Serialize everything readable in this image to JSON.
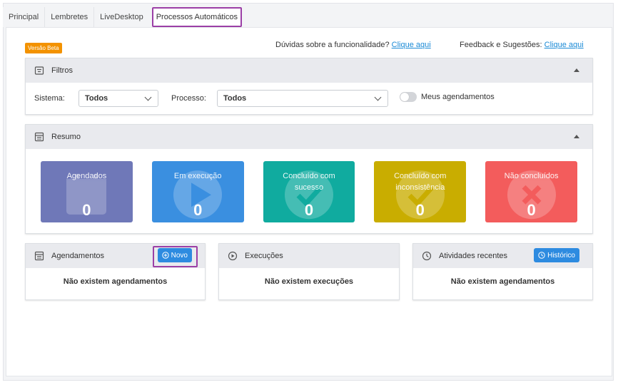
{
  "tabs": [
    {
      "label": "Principal"
    },
    {
      "label": "Lembretes"
    },
    {
      "label": "LiveDesktop"
    },
    {
      "label": "Processos Automáticos"
    }
  ],
  "beta_badge": "Versão Beta",
  "help": {
    "doubts_text": "Dúvidas sobre a funcionalidade?",
    "doubts_link": "Clique aqui",
    "feedback_text": "Feedback e Sugestões:",
    "feedback_link": "Clique aqui"
  },
  "filters": {
    "title": "Filtros",
    "system_label": "Sistema:",
    "system_value": "Todos",
    "process_label": "Processo:",
    "process_value": "Todos",
    "my_schedules_label": "Meus agendamentos"
  },
  "summary": {
    "title": "Resumo",
    "cards": [
      {
        "title": "Agendados",
        "value": "0",
        "color": "#6f78b8"
      },
      {
        "title": "Em execução",
        "value": "0",
        "color": "#3a8fe0"
      },
      {
        "title": "Concluído com sucesso",
        "value": "0",
        "color": "#10ab9f"
      },
      {
        "title": "Concluído com inconsistência",
        "value": "0",
        "color": "#c9ad00"
      },
      {
        "title": "Não concluídos",
        "value": "0",
        "color": "#f35c5c"
      }
    ]
  },
  "schedules": {
    "title": "Agendamentos",
    "button": "Novo",
    "empty": "Não existem agendamentos"
  },
  "executions": {
    "title": "Execuções",
    "empty": "Não existem execuções"
  },
  "recent": {
    "title": "Atividades recentes",
    "button": "Histórico",
    "empty": "Não existem agendamentos"
  }
}
